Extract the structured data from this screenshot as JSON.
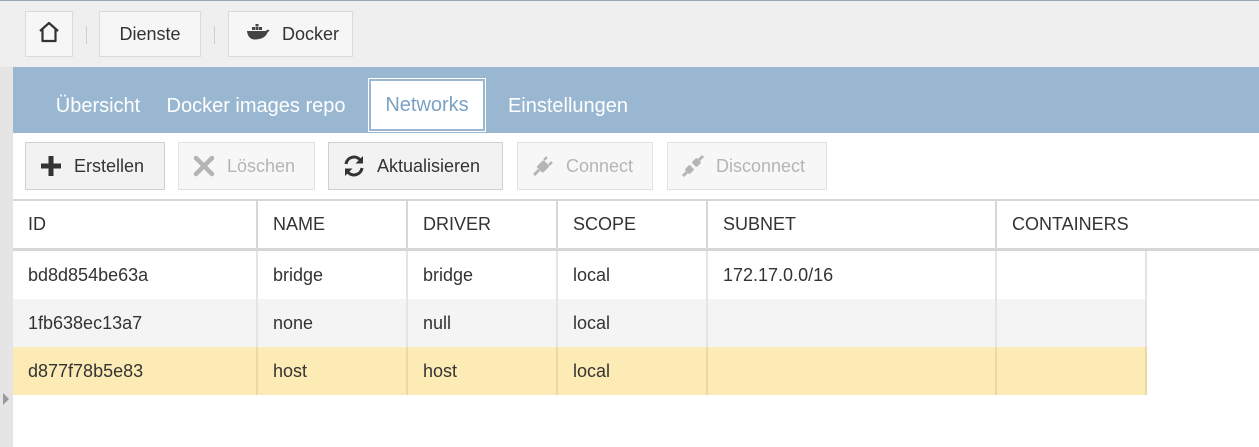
{
  "breadcrumb": {
    "home_icon": "home-icon",
    "items": [
      {
        "label": "Dienste"
      },
      {
        "label": "Docker",
        "icon": "docker-whale-icon"
      }
    ]
  },
  "tabs": [
    {
      "label": "Übersicht",
      "active": false
    },
    {
      "label": "Docker images repo",
      "active": false
    },
    {
      "label": "Networks",
      "active": true
    },
    {
      "label": "Einstellungen",
      "active": false
    }
  ],
  "toolbar": {
    "buttons": [
      {
        "label": "Erstellen",
        "icon": "plus-icon",
        "enabled": true
      },
      {
        "label": "Löschen",
        "icon": "x-icon",
        "enabled": false
      },
      {
        "label": "Aktualisieren",
        "icon": "refresh-icon",
        "enabled": true
      },
      {
        "label": "Connect",
        "icon": "plug-connect-icon",
        "enabled": false
      },
      {
        "label": "Disconnect",
        "icon": "plug-disconnect-icon",
        "enabled": false
      }
    ]
  },
  "table": {
    "columns": [
      "ID",
      "NAME",
      "DRIVER",
      "SCOPE",
      "SUBNET",
      "CONTAINERS"
    ],
    "rows": [
      {
        "id": "bd8d854be63a",
        "name": "bridge",
        "driver": "bridge",
        "scope": "local",
        "subnet": "172.17.0.0/16",
        "containers": ""
      },
      {
        "id": "1fb638ec13a7",
        "name": "none",
        "driver": "null",
        "scope": "local",
        "subnet": "",
        "containers": ""
      },
      {
        "id": "d877f78b5e83",
        "name": "host",
        "driver": "host",
        "scope": "local",
        "subnet": "",
        "containers": "",
        "selected": true
      }
    ]
  },
  "colors": {
    "tab_bar": "#99b7d0",
    "active_tab_text": "#7ba2c4",
    "selected_row": "#fcebb5",
    "alt_row": "#f4f4f4"
  }
}
